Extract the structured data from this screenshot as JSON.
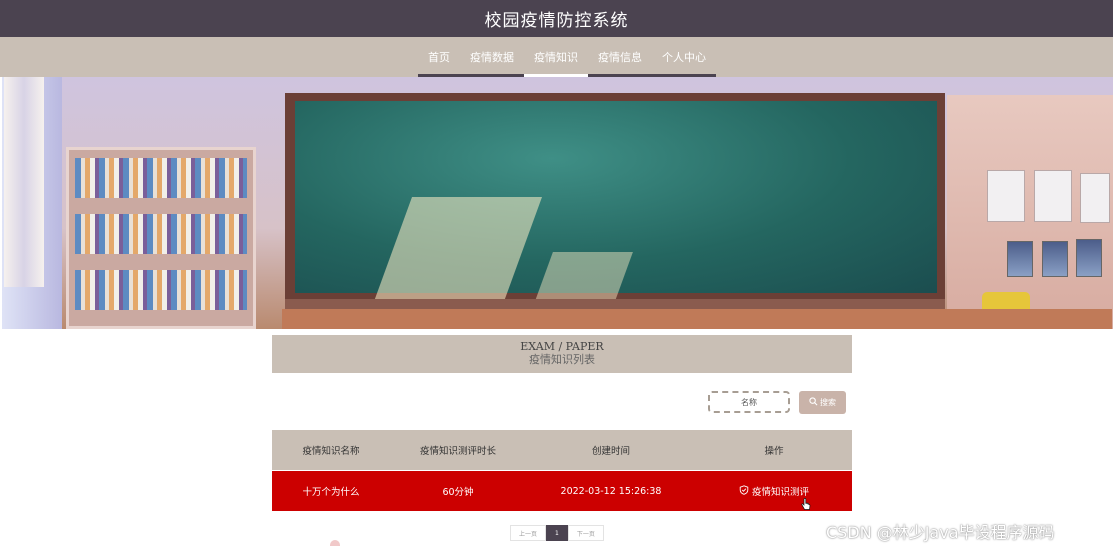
{
  "header": {
    "title": "校园疫情防控系统"
  },
  "nav": {
    "items": [
      "首页",
      "疫情数据",
      "疫情知识",
      "疫情信息",
      "个人中心"
    ],
    "active": "疫情知识"
  },
  "section": {
    "en": "EXAM / PAPER",
    "cn": "疫情知识列表"
  },
  "search": {
    "placeholder": "名称",
    "button_label": "搜索"
  },
  "table": {
    "headers": [
      "疫情知识名称",
      "疫情知识测评时长",
      "创建时间",
      "操作"
    ],
    "rows": [
      {
        "name": "十万个为什么",
        "duration": "60分钟",
        "created": "2022-03-12 15:26:38",
        "action": "疫情知识测评"
      }
    ]
  },
  "pagination": {
    "prev": "上一页",
    "current": "1",
    "next": "下一页"
  },
  "watermark": "CSDN @林少Java毕设程序源码",
  "colors": {
    "header_bg": "#4b4350",
    "nav_bg": "#c9bfb5",
    "row_highlight": "#cc0000"
  }
}
